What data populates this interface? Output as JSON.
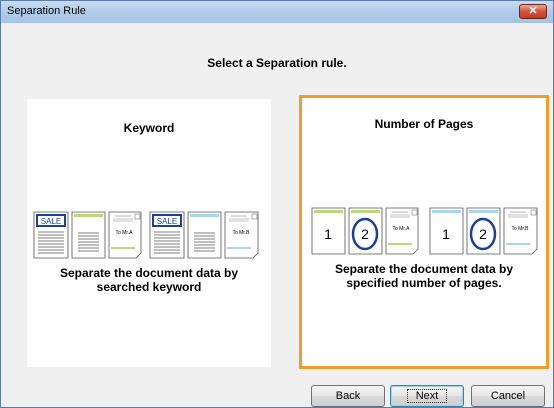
{
  "window": {
    "title": "Separation Rule",
    "close_glyph": "✕"
  },
  "heading": "Select a Separation rule.",
  "options": {
    "keyword": {
      "title": "Keyword",
      "description_line1": "Separate the document data by",
      "description_line2": "searched keyword",
      "sale_label": "SALE",
      "memo_label": "To Mr.A",
      "memo_label_2": "To Mr.B"
    },
    "pages": {
      "title": "Number of Pages",
      "description_line1": "Separate the document data by",
      "description_line2": "specified number of pages.",
      "page_one": "1",
      "page_two": "2",
      "memo_label": "To Mr.A",
      "memo_label_2": "To Mr.B",
      "highlight_color": "#f39c2a",
      "circle_color": "#1c3f9c"
    }
  },
  "buttons": {
    "back": "Back",
    "next": "Next",
    "cancel": "Cancel"
  }
}
